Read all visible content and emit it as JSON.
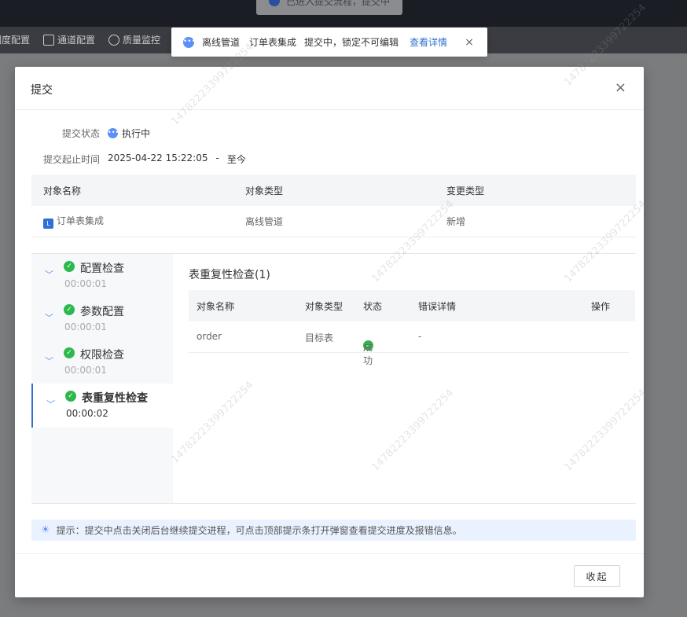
{
  "background": {
    "top_toast": "已进入提交流程，提交中",
    "nav": [
      {
        "label": "调度配置",
        "icon": "config-icon"
      },
      {
        "label": "通道配置",
        "icon": "channel-icon"
      },
      {
        "label": "质量监控",
        "icon": "quality-icon"
      }
    ]
  },
  "notice": {
    "type": "离线管道",
    "name": "订单表集成",
    "message": "提交中，锁定不可编辑",
    "link": "查看详情",
    "close": "×"
  },
  "modal": {
    "title": "提交",
    "close": "×",
    "status_label": "提交状态",
    "status_value": "执行中",
    "time_label": "提交起止时间",
    "time_start": "2025-04-22 15:22:05",
    "time_sep": "-",
    "time_end": "至今",
    "object_table": {
      "headers": [
        "对象名称",
        "对象类型",
        "变更类型"
      ],
      "rows": [
        {
          "name": "订单表集成",
          "type": "离线管道",
          "change": "新增"
        }
      ]
    },
    "steps": [
      {
        "name": "配置检查",
        "time": "00:00:01"
      },
      {
        "name": "参数配置",
        "time": "00:00:01"
      },
      {
        "name": "权限检查",
        "time": "00:00:01"
      },
      {
        "name": "表重复性检查",
        "time": "00:00:02"
      }
    ],
    "panel_title": "表重复性检查(1)",
    "check_table": {
      "headers": [
        "对象名称",
        "对象类型",
        "状态",
        "错误详情",
        "操作"
      ],
      "rows": [
        {
          "name": "order",
          "type": "目标表",
          "status": "成功",
          "error": "-",
          "action": ""
        }
      ]
    },
    "tip": "提示：提交中点击关闭后台继续提交进程，可点击顶部提示条打开弹窗查看提交进度及报错信息。",
    "collapse_button": "收起"
  },
  "watermark": "14782223399722254",
  "colors": {
    "primary": "#2f6fd6",
    "success": "#2db84d",
    "info": "#5b8ff9"
  }
}
